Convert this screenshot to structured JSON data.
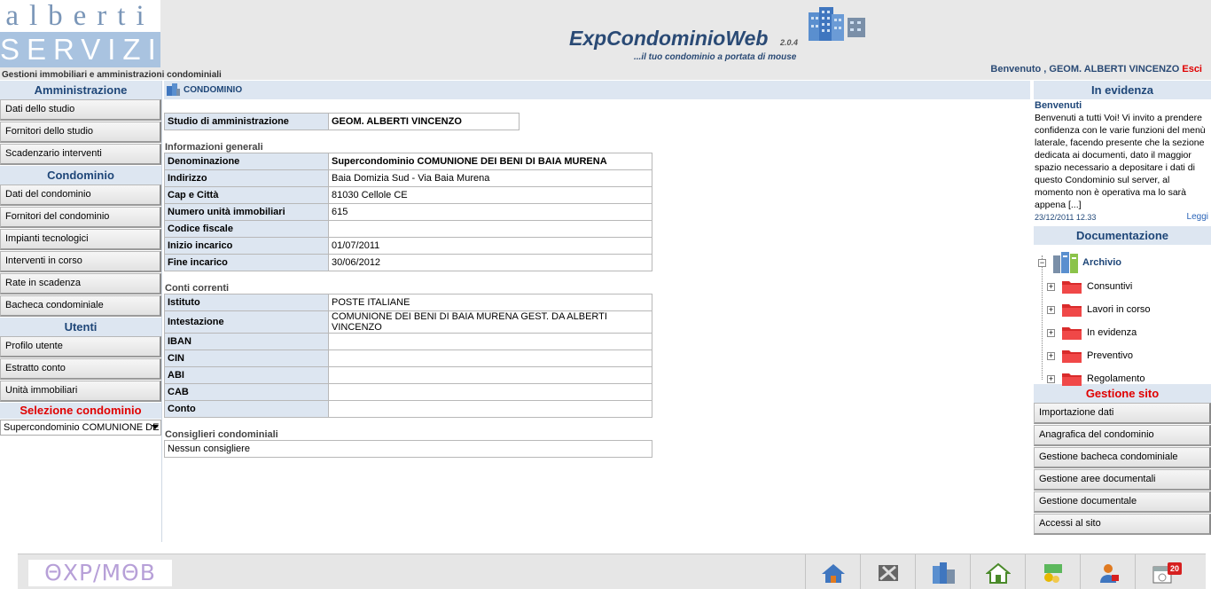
{
  "header": {
    "logo_top": "alberti",
    "logo_bottom": "SERVIZI",
    "tagline": "Gestioni immobiliari e amministrazioni condominiali",
    "app_title": "ExpCondominioWeb",
    "app_version": "2.0.4",
    "app_subtitle": "...il tuo condominio a portata di mouse",
    "welcome": "Benvenuto , GEOM. ALBERTI VINCENZO",
    "logout": "Esci"
  },
  "sidebar": {
    "amministrazione": {
      "title": "Amministrazione",
      "items": [
        "Dati dello studio",
        "Fornitori dello studio",
        "Scadenzario interventi"
      ]
    },
    "condominio": {
      "title": "Condominio",
      "items": [
        "Dati del condominio",
        "Fornitori del condominio",
        "Impianti tecnologici",
        "Interventi in corso",
        "Rate in scadenza",
        "Bacheca condominiale"
      ]
    },
    "utenti": {
      "title": "Utenti",
      "items": [
        "Profilo utente",
        "Estratto conto",
        "Unità immobiliari"
      ]
    },
    "selezione": {
      "title": "Selezione condominio",
      "value": "Supercondominio COMUNIONE DE"
    }
  },
  "main": {
    "header": "CONDOMINIO",
    "studio": {
      "label": "Studio di amministrazione",
      "value": "GEOM. ALBERTI VINCENZO"
    },
    "info_title": "Informazioni generali",
    "info": [
      {
        "label": "Denominazione",
        "value": "Supercondominio COMUNIONE DEI BENI DI BAIA MURENA"
      },
      {
        "label": "Indirizzo",
        "value": "Baia Domizia Sud - Via Baia Murena"
      },
      {
        "label": "Cap e Città",
        "value": "81030 Cellole CE"
      },
      {
        "label": "Numero unità immobiliari",
        "value": "615"
      },
      {
        "label": "Codice fiscale",
        "value": ""
      },
      {
        "label": "Inizio incarico",
        "value": "01/07/2011"
      },
      {
        "label": "Fine incarico",
        "value": "30/06/2012"
      }
    ],
    "conti_title": "Conti correnti",
    "conti": [
      {
        "label": "Istituto",
        "value": "POSTE ITALIANE"
      },
      {
        "label": "Intestazione",
        "value": "COMUNIONE DEI BENI DI BAIA MURENA GEST. DA ALBERTI VINCENZO"
      },
      {
        "label": "IBAN",
        "value": ""
      },
      {
        "label": "CIN",
        "value": ""
      },
      {
        "label": "ABI",
        "value": ""
      },
      {
        "label": "CAB",
        "value": ""
      },
      {
        "label": "Conto",
        "value": ""
      }
    ],
    "consiglieri_title": "Consiglieri condominiali",
    "consiglieri_value": "Nessun consigliere"
  },
  "right": {
    "evidenza_title": "In evidenza",
    "news_title": "Benvenuti",
    "news_text": "Benvenuti a tutti Voi! Vi invito a prendere confidenza con le varie funzioni del menù laterale, facendo presente che la sezione dedicata ai documenti, dato il maggior spazio necessario a depositare i dati di questo Condominio sul server, al momento non è operativa ma lo sarà appena [...]",
    "news_date": "23/12/2011 12.33",
    "news_more": "Leggi",
    "doc_title": "Documentazione",
    "archive_label": "Archivio",
    "folders": [
      "Consuntivi",
      "Lavori in corso",
      "In evidenza",
      "Preventivo",
      "Regolamento"
    ],
    "gestione_title": "Gestione sito",
    "gestione_items": [
      "Importazione dati",
      "Anagrafica del condominio",
      "Gestione bacheca condominiale",
      "Gestione aree documentali",
      "Gestione documentale",
      "Accessi al sito"
    ]
  },
  "footer": {
    "logo_text": "ΘΧΡ/ΜΘΒ ΕΧ",
    "icons": [
      "home-icon",
      "tools-icon",
      "buildings-icon",
      "house-icon",
      "money-icon",
      "users-icon",
      "calendar-icon"
    ],
    "badge": "20"
  },
  "colors": {
    "header_bg": "#e8e8e8",
    "section_bg": "#dde6f1",
    "title_blue": "#1e4678",
    "red": "#e00000"
  }
}
